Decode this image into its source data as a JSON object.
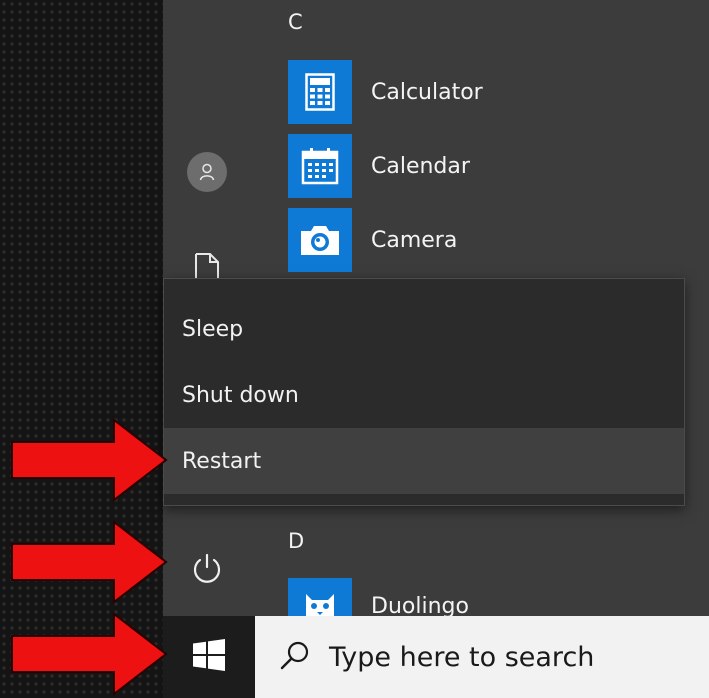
{
  "start_menu": {
    "sections": [
      {
        "letter": "C",
        "apps": [
          {
            "label": "Calculator",
            "icon": "calculator-icon"
          },
          {
            "label": "Calendar",
            "icon": "calendar-icon"
          },
          {
            "label": "Camera",
            "icon": "camera-icon"
          }
        ]
      },
      {
        "letter": "D",
        "apps": [
          {
            "label": "Duolingo",
            "icon": "duolingo-owl-icon"
          }
        ]
      }
    ],
    "rail_icons": [
      "user-avatar-icon",
      "document-icon",
      "power-icon"
    ]
  },
  "power_menu": {
    "items": [
      {
        "label": "Sleep",
        "hovered": false
      },
      {
        "label": "Shut down",
        "hovered": false
      },
      {
        "label": "Restart",
        "hovered": true
      }
    ]
  },
  "taskbar": {
    "start_icon": "windows-logo-icon",
    "search_placeholder": "Type here to search"
  },
  "annotations": {
    "arrow_color": "#ee1111",
    "arrow_count": 3
  },
  "colors": {
    "tile_blue": "#0f7ad6",
    "menu_bg": "#3c3c3c",
    "power_menu_bg": "#2b2b2b",
    "taskbar_bg": "#1c1c1c"
  }
}
